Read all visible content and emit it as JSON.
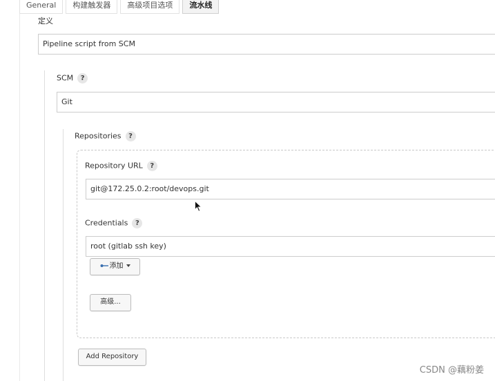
{
  "tabs": [
    {
      "label": "General"
    },
    {
      "label": "构建触发器"
    },
    {
      "label": "高级项目选项"
    },
    {
      "label": "流水线",
      "active": true
    }
  ],
  "definition": {
    "label": "定义",
    "value": "Pipeline script from SCM"
  },
  "scm": {
    "label": "SCM",
    "help": "?",
    "value": "Git"
  },
  "repositories": {
    "label": "Repositories",
    "help": "?",
    "url_label": "Repository URL",
    "url_help": "?",
    "url_value": "git@172.25.0.2:root/devops.git",
    "credentials_label": "Credentials",
    "credentials_help": "?",
    "credentials_value": "root (gitlab ssh key)",
    "add_button": "添加",
    "advanced_button": "高级...",
    "add_repository_button": "Add Repository"
  },
  "watermark": "CSDN @藕粉姜",
  "colors": {
    "key_icon": "#3a6fb0"
  }
}
